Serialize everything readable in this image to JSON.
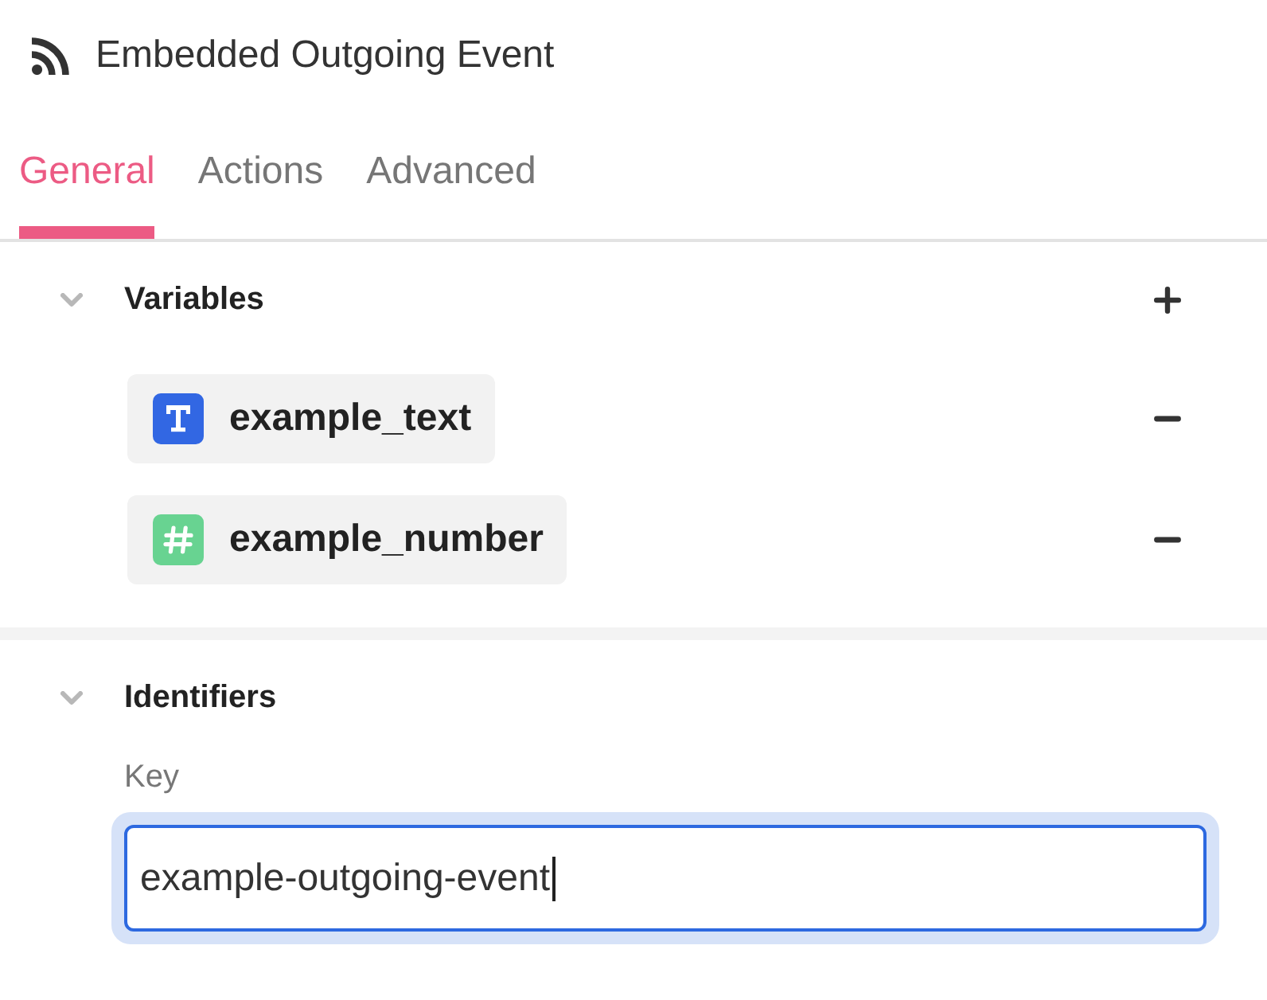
{
  "header": {
    "title": "Embedded Outgoing Event"
  },
  "tabs": [
    {
      "label": "General",
      "selected": true
    },
    {
      "label": "Actions",
      "selected": false
    },
    {
      "label": "Advanced",
      "selected": false
    }
  ],
  "sections": [
    {
      "kind": "variables",
      "title": "Variables",
      "expanded": true,
      "variables": [
        {
          "name": "example_text",
          "kind": "text",
          "color": "#3267e3"
        },
        {
          "name": "example_number",
          "kind": "number",
          "color": "#68d391"
        }
      ]
    },
    {
      "kind": "identifiers",
      "title": "Identifiers",
      "expanded": true,
      "field": {
        "label": "Key",
        "value": "example-outgoing-event",
        "focused": true
      }
    }
  ]
}
